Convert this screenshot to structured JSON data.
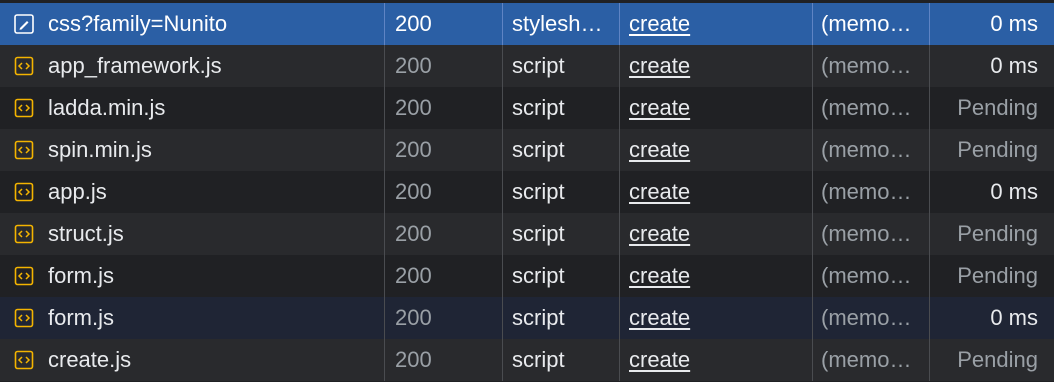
{
  "rows": [
    {
      "name": "css?family=Nunito",
      "status": "200",
      "type": "stylesh…",
      "initiator": "create",
      "size": "(memo…",
      "time": "0 ms",
      "icon": "stylesheet-icon",
      "state": "selected"
    },
    {
      "name": "app_framework.js",
      "status": "200",
      "type": "script",
      "initiator": "create",
      "size": "(memo…",
      "time": "0 ms",
      "icon": "script-icon",
      "state": "normal"
    },
    {
      "name": "ladda.min.js",
      "status": "200",
      "type": "script",
      "initiator": "create",
      "size": "(memo…",
      "time": "Pending",
      "icon": "script-icon",
      "state": "normal"
    },
    {
      "name": "spin.min.js",
      "status": "200",
      "type": "script",
      "initiator": "create",
      "size": "(memo…",
      "time": "Pending",
      "icon": "script-icon",
      "state": "normal"
    },
    {
      "name": "app.js",
      "status": "200",
      "type": "script",
      "initiator": "create",
      "size": "(memo…",
      "time": "0 ms",
      "icon": "script-icon",
      "state": "normal"
    },
    {
      "name": "struct.js",
      "status": "200",
      "type": "script",
      "initiator": "create",
      "size": "(memo…",
      "time": "Pending",
      "icon": "script-icon",
      "state": "normal"
    },
    {
      "name": "form.js",
      "status": "200",
      "type": "script",
      "initiator": "create",
      "size": "(memo…",
      "time": "Pending",
      "icon": "script-icon",
      "state": "normal"
    },
    {
      "name": "form.js",
      "status": "200",
      "type": "script",
      "initiator": "create",
      "size": "(memo…",
      "time": "0 ms",
      "icon": "script-icon",
      "state": "hover"
    },
    {
      "name": "create.js",
      "status": "200",
      "type": "script",
      "initiator": "create",
      "size": "(memo…",
      "time": "Pending",
      "icon": "script-icon",
      "state": "normal"
    }
  ],
  "colors": {
    "selected_row": "#2b5fa5",
    "hover_row": "#1f2535",
    "script_icon": "#f4b400",
    "stylesheet_icon": "#ffffff"
  }
}
